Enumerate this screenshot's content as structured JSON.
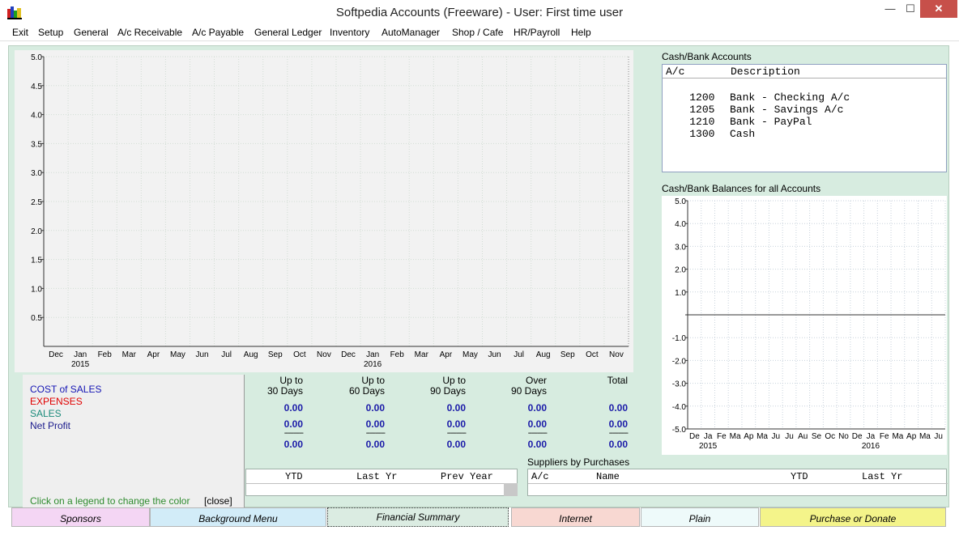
{
  "window": {
    "title": "Softpedia Accounts (Freeware)  -  User: First time user",
    "minimize": "—",
    "maximize": "☐",
    "close": "✕"
  },
  "menu": [
    "Exit",
    "Setup",
    "General",
    "A/c Receivable",
    "A/c Payable",
    "General Ledger",
    "Inventory",
    "AutoManager",
    "Shop / Cafe",
    "HR/Payroll",
    "Help"
  ],
  "main_chart": {
    "y_ticks": [
      "5.0",
      "4.5",
      "4.0",
      "3.5",
      "3.0",
      "2.5",
      "2.0",
      "1.5",
      "1.0",
      "0.5"
    ],
    "months": [
      "Dec",
      "Jan",
      "Feb",
      "Mar",
      "Apr",
      "May",
      "Jun",
      "Jul",
      "Aug",
      "Sep",
      "Oct",
      "Nov",
      "Dec",
      "Jan",
      "Feb",
      "Mar",
      "Apr",
      "May",
      "Jun",
      "Jul",
      "Aug",
      "Sep",
      "Oct",
      "Nov"
    ],
    "years": [
      "2015",
      "2016"
    ]
  },
  "legend": {
    "items": [
      {
        "label": "COST of SALES",
        "color": "#1414b4"
      },
      {
        "label": "EXPENSES",
        "color": "#e00000"
      },
      {
        "label": "SALES",
        "color": "#1a8a7a"
      },
      {
        "label": "Net Profit",
        "color": "#1a1a8c"
      }
    ],
    "hint": "Click on a legend to change the color",
    "close": "[close]"
  },
  "aging": {
    "headers": [
      {
        "line1": "Up to",
        "line2": "30 Days"
      },
      {
        "line1": "Up to",
        "line2": "60 Days"
      },
      {
        "line1": "Up to",
        "line2": "90 Days"
      },
      {
        "line1": "Over",
        "line2": "90 Days"
      },
      {
        "line1": "",
        "line2": "Total"
      }
    ],
    "row1": [
      "0.00",
      "0.00",
      "0.00",
      "0.00",
      "0.00"
    ],
    "row2": [
      "0.00",
      "0.00",
      "0.00",
      "0.00",
      "0.00"
    ],
    "dashes": "----------",
    "row3": [
      "0.00",
      "0.00",
      "0.00",
      "0.00",
      "0.00"
    ]
  },
  "customer_table": {
    "columns": [
      "YTD",
      "Last Yr",
      "Prev Year"
    ]
  },
  "suppliers": {
    "title": "Suppliers by Purchases",
    "columns": [
      "A/c",
      "Name",
      "YTD",
      "Last Yr"
    ]
  },
  "cash_bank": {
    "title": "Cash/Bank Accounts",
    "columns": [
      "A/c",
      "Description"
    ],
    "rows": [
      {
        "ac": "1200",
        "desc": "Bank - Checking A/c"
      },
      {
        "ac": "1205",
        "desc": "Bank - Savings A/c"
      },
      {
        "ac": "1210",
        "desc": "Bank - PayPal"
      },
      {
        "ac": "1300",
        "desc": "Cash"
      }
    ]
  },
  "balances_chart": {
    "title": "Cash/Bank Balances for all Accounts",
    "y_ticks": [
      "5.0",
      "4.0",
      "3.0",
      "2.0",
      "1.0",
      "",
      "-1.0",
      "-2.0",
      "-3.0",
      "-4.0",
      "-5.0"
    ],
    "months": [
      "De",
      "Ja",
      "Fe",
      "Ma",
      "Ap",
      "Ma",
      "Ju",
      "Ju",
      "Au",
      "Se",
      "Oc",
      "No",
      "De",
      "Ja",
      "Fe",
      "Ma",
      "Ap",
      "Ma",
      "Ju"
    ],
    "years": [
      "2015",
      "2016"
    ]
  },
  "buttons": [
    {
      "label": "Sponsors",
      "color": "#f4d6f4"
    },
    {
      "label": "Background Menu",
      "color": "#d2ecf8"
    },
    {
      "label": "Financial Summary",
      "color": "#dbece2"
    },
    {
      "label": "Internet",
      "color": "#f8d8d2"
    },
    {
      "label": "Plain",
      "color": "#eefafa"
    },
    {
      "label": "Purchase or Donate",
      "color": "#f4f48a"
    }
  ]
}
